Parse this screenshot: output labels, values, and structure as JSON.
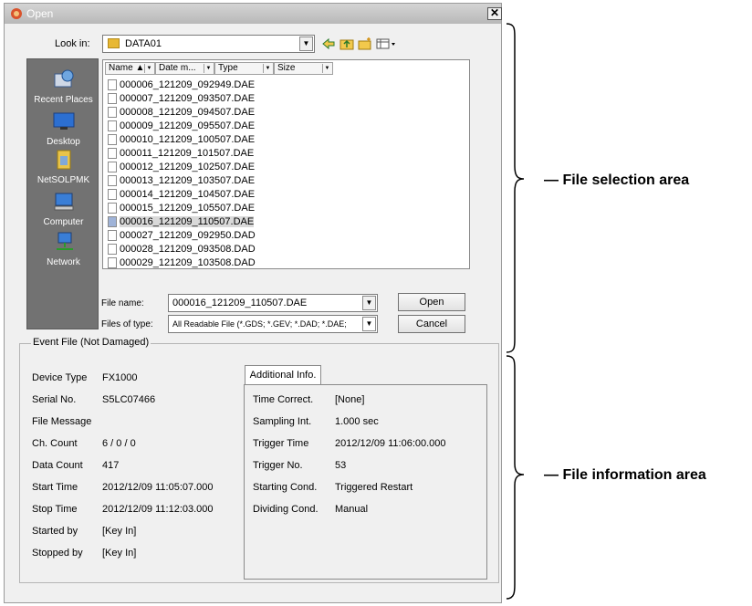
{
  "dialog": {
    "title": "Open",
    "close_label": "✕"
  },
  "lookin": {
    "label": "Look in:",
    "value": "DATA01"
  },
  "places": [
    {
      "label": "Recent Places",
      "icon": "recent-places-icon"
    },
    {
      "label": "Desktop",
      "icon": "desktop-icon"
    },
    {
      "label": "NetSOLPMK",
      "icon": "user-folder-icon"
    },
    {
      "label": "Computer",
      "icon": "computer-icon"
    },
    {
      "label": "Network",
      "icon": "network-icon"
    }
  ],
  "filelist": {
    "columns": [
      "Name",
      "Date m...",
      "Type",
      "Size"
    ],
    "files": [
      "000006_121209_092949.DAE",
      "000007_121209_093507.DAE",
      "000008_121209_094507.DAE",
      "000009_121209_095507.DAE",
      "000010_121209_100507.DAE",
      "000011_121209_101507.DAE",
      "000012_121209_102507.DAE",
      "000013_121209_103507.DAE",
      "000014_121209_104507.DAE",
      "000015_121209_105507.DAE",
      "000016_121209_110507.DAE",
      "000027_121209_092950.DAD",
      "000028_121209_093508.DAD",
      "000029_121209_103508.DAD"
    ],
    "selected": "000016_121209_110507.DAE"
  },
  "filename": {
    "label": "File name:",
    "value": "000016_121209_110507.DAE"
  },
  "filetype": {
    "label": "Files of type:",
    "value": "All Readable File (*.GDS; *.GEV; *.DAD; *.DAE;"
  },
  "buttons": {
    "open": "Open",
    "cancel": "Cancel"
  },
  "event": {
    "group_title": "Event File (Not Damaged)",
    "fields": [
      {
        "label": "Device Type",
        "value": "FX1000"
      },
      {
        "label": "Serial No.",
        "value": "S5LC07466"
      },
      {
        "label": "File Message",
        "value": ""
      },
      {
        "label": "Ch. Count",
        "value": "6 / 0 / 0"
      },
      {
        "label": "Data Count",
        "value": "417"
      },
      {
        "label": "Start Time",
        "value": "2012/12/09 11:05:07.000"
      },
      {
        "label": "Stop Time",
        "value": "2012/12/09 11:12:03.000"
      },
      {
        "label": "Started by",
        "value": "[Key In]"
      },
      {
        "label": "Stopped by",
        "value": "[Key In]"
      }
    ],
    "tab_label": "Additional Info.",
    "additional": [
      {
        "label": "Time Correct.",
        "value": "[None]"
      },
      {
        "label": "Sampling Int.",
        "value": "1.000 sec"
      },
      {
        "label": "Trigger Time",
        "value": "2012/12/09 11:06:00.000"
      },
      {
        "label": "Trigger No.",
        "value": "53"
      },
      {
        "label": "Starting Cond.",
        "value": "Triggered Restart"
      },
      {
        "label": "Dividing Cond.",
        "value": "Manual"
      }
    ]
  },
  "annotations": {
    "selection": "File selection area",
    "information": "File information area"
  }
}
